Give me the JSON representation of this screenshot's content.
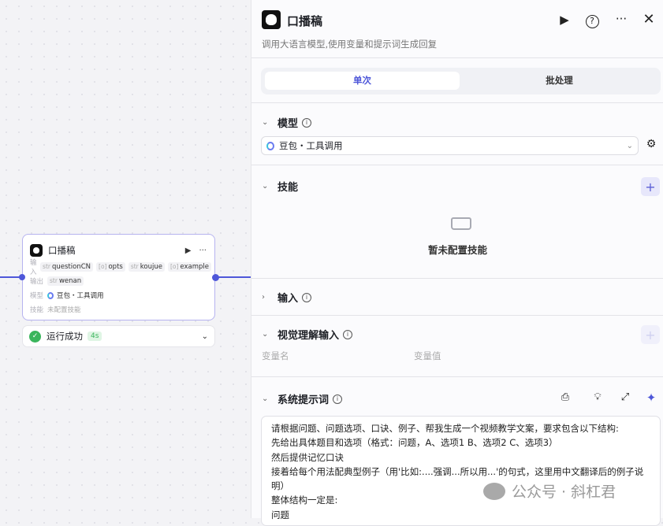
{
  "node": {
    "title": "口播稿",
    "input_label": "输入",
    "output_label": "输出",
    "model_label": "模型",
    "skill_label": "技能",
    "inputs": [
      {
        "type": "str",
        "name": "questionCN"
      },
      {
        "type": "[o]",
        "name": "opts"
      },
      {
        "type": "str",
        "name": "koujue"
      },
      {
        "type": "[o]",
        "name": "example"
      }
    ],
    "outputs": [
      {
        "type": "str",
        "name": "wenan"
      }
    ],
    "model": "豆包・工具调用",
    "skills": "未配置技能",
    "status": "运行成功",
    "duration": "4s"
  },
  "panel": {
    "title": "口播稿",
    "description": "调用大语言模型,使用变量和提示词生成回复",
    "tabs": [
      {
        "label": "单次",
        "active": true
      },
      {
        "label": "批处理",
        "active": false
      }
    ],
    "model_section": {
      "title": "模型",
      "selected": "豆包・工具调用"
    },
    "skill_section": {
      "title": "技能",
      "empty": "暂未配置技能"
    },
    "input_section": {
      "title": "输入"
    },
    "vision_section": {
      "title": "视觉理解输入",
      "col_name": "变量名",
      "col_value": "变量值"
    },
    "prompt_section": {
      "title": "系统提示词",
      "lines": [
        "请根据问题、问题选项、口诀、例子、帮我生成一个视频教学文案，要求包含以下结构:",
        "先给出具体题目和选项（格式：问题，A、选项1 B、选项2 C、选项3）",
        "然后提供记忆口诀",
        "接着给每个用法配典型例子（用'比如:....强调...所以用...'的句式，这里用中文翻译后的例子说明）",
        "整体结构一定是:",
        "问题"
      ]
    }
  },
  "watermark": "公众号 · 斜杠君",
  "colors": {
    "accent": "#4e57d9",
    "success": "#3ab55c"
  }
}
